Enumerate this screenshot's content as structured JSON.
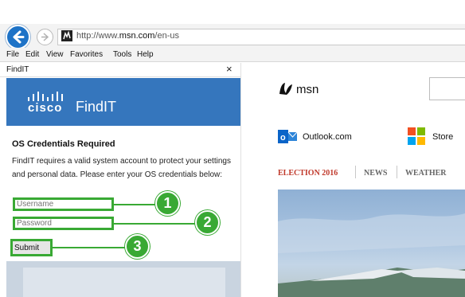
{
  "browser": {
    "url_prefix": "http://www.",
    "url_domain": "msn.com",
    "url_suffix": "/en-us"
  },
  "menu": [
    "File",
    "Edit",
    "View",
    "Favorites",
    "Tools",
    "Help"
  ],
  "pane": {
    "title": "FindIT",
    "close_glyph": "×"
  },
  "findit": {
    "app_name": "FindIT",
    "logo_text": "cisco",
    "heading": "OS Credentials Required",
    "description": "FindIT requires a valid system account to protect your settings and personal data. Please enter your OS credentials below:",
    "username_placeholder": "Username",
    "password_placeholder": "Password",
    "submit_label": "Submit"
  },
  "callouts": [
    "1",
    "2",
    "3"
  ],
  "msn": {
    "logo_text": "msn",
    "links": {
      "outlook": "Outlook.com",
      "store": "Store"
    },
    "nav": [
      "ELECTION 2016",
      "NEWS",
      "WEATHER"
    ]
  },
  "colors": {
    "accent_green": "#39a934",
    "findit_blue": "#3576bd",
    "election_red": "#c0392b",
    "nav_gray": "#666666"
  }
}
